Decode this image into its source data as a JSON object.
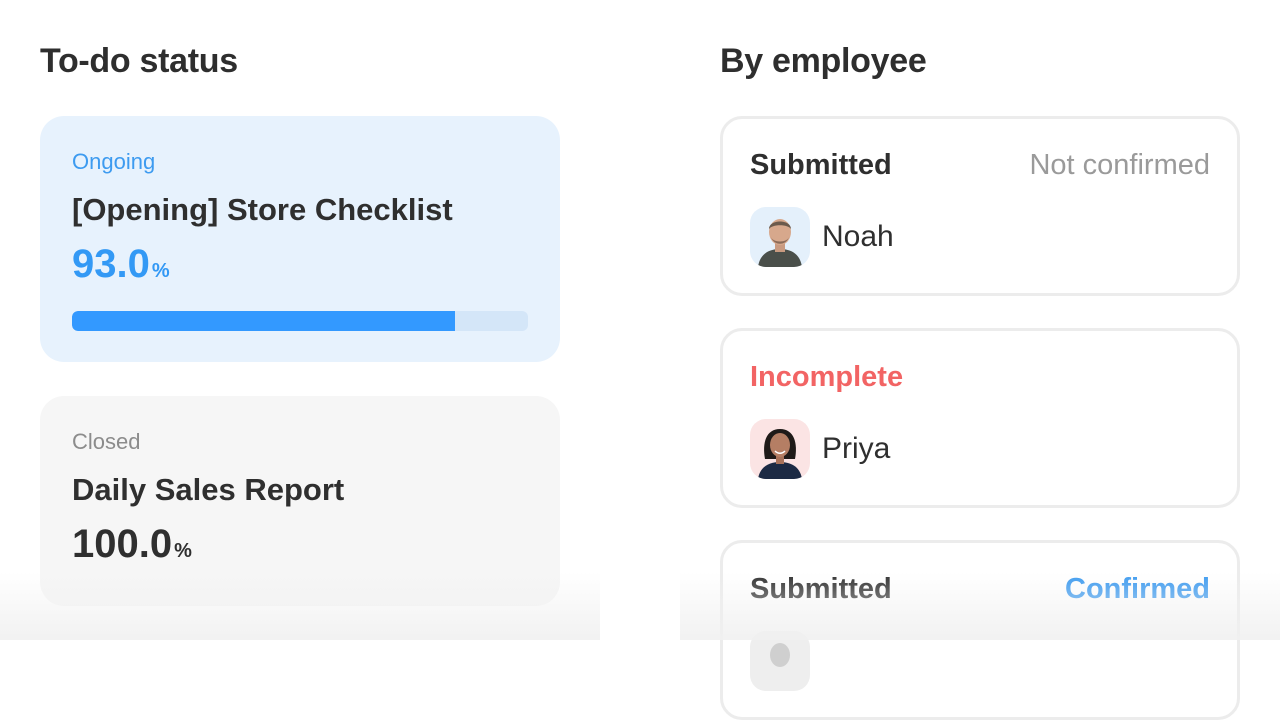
{
  "todo_section": {
    "heading": "To-do status",
    "cards": [
      {
        "status": "Ongoing",
        "title": "[Opening] Store Checklist",
        "percent_value": "93.0",
        "percent_unit": "%",
        "progress_fraction": 0.84
      },
      {
        "status": "Closed",
        "title": "Daily Sales Report",
        "percent_value": "100.0",
        "percent_unit": "%"
      }
    ]
  },
  "employee_section": {
    "heading": "By employee",
    "cards": [
      {
        "status": "Submitted",
        "confirmation": "Not confirmed",
        "name": "Noah",
        "avatar": "man-photo-avatar"
      },
      {
        "status": "Incomplete",
        "confirmation": "",
        "name": "Priya",
        "avatar": "woman-photo-avatar"
      },
      {
        "status": "Submitted",
        "confirmation": "Confirmed",
        "name": "",
        "avatar": "person-photo-avatar"
      }
    ]
  },
  "colors": {
    "accent_blue": "#3399ff",
    "ongoing_card_bg": "#e7f2fd",
    "closed_card_bg": "#f6f6f6",
    "incomplete_red": "#f26464",
    "muted_grey": "#9a9a9a"
  }
}
